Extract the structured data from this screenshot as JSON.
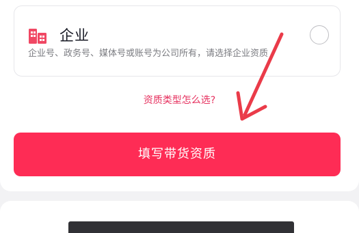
{
  "option": {
    "title": "企业",
    "description": "企业号、政务号、媒体号或账号为公司所有，请选择企业资质",
    "icon": "building-icon",
    "selected": false
  },
  "help_link": "资质类型怎么选?",
  "primary_button": "填写带货资质",
  "colors": {
    "accent": "#fe2c55",
    "link": "#e6315f",
    "annotation_arrow": "#ea3b49"
  }
}
